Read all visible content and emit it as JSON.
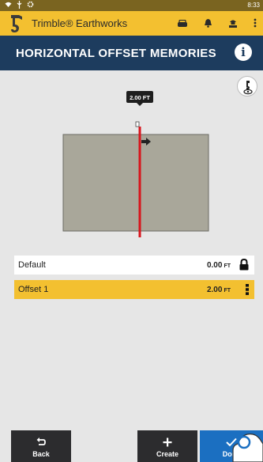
{
  "statusbar": {
    "time": "8:33"
  },
  "app": {
    "title": "Trimble® Earthworks"
  },
  "page": {
    "title": "HORIZONTAL OFFSET MEMORIES"
  },
  "diagram": {
    "offset_label": "2.00 FT"
  },
  "offsets": [
    {
      "name": "Default",
      "value": "0.00",
      "unit": "FT",
      "locked": true
    },
    {
      "name": "Offset 1",
      "value": "2.00",
      "unit": "FT",
      "selected": true
    }
  ],
  "buttons": {
    "back": {
      "label": "Back",
      "icon": "back-arrow-icon"
    },
    "create": {
      "label": "Create",
      "icon": "plus-icon"
    },
    "done": {
      "label": "Done",
      "icon": "check-icon"
    }
  },
  "colors": {
    "accent_yellow": "#f3c030",
    "title_blue": "#1d3c5e",
    "done_blue": "#1b6fc1",
    "offset_line_red": "#d8141c",
    "surface_gray": "#a9a79a"
  }
}
